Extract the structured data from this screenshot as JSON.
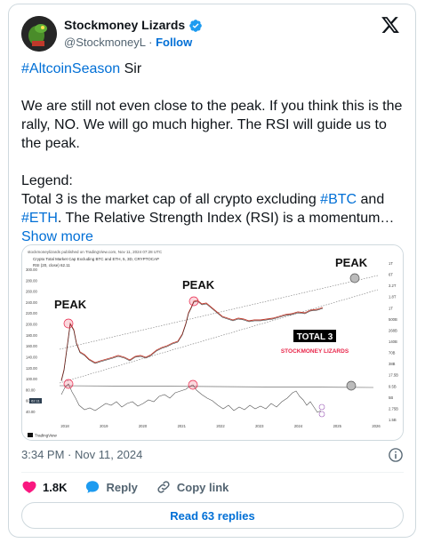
{
  "author": {
    "name": "Stockmoney Lizards",
    "handle": "@StockmoneyL",
    "separator": "·",
    "follow_label": "Follow"
  },
  "tweet": {
    "hashtag": "#AltcoinSeason",
    "hashtag_suffix": " Sir",
    "para2": "We are still not even close to the peak. If you think this is the rally, NO. We will go much higher.  The RSI will guide us to the peak.",
    "legend_heading": "Legend:",
    "legend_text_1": "Total 3 is the market cap of all crypto excluding ",
    "btc_tag": "#BTC",
    "legend_text_2": " and ",
    "eth_tag": "#ETH",
    "legend_text_3": ". The Relative Strength Index (RSI) is a momentum… ",
    "show_more": "Show more"
  },
  "chart": {
    "source_label": "stockmoneylizards published on TradingView.com, Nov 11, 2024 07:28 UTC",
    "series_label": "Crypto Total Market Cap Excluding BTC and ETH, 5, 3D, CRYPTOCAP",
    "rsi_label": "RSI (20, close)  62.11",
    "annotation_peak_1": "PEAK",
    "annotation_peak_2": "PEAK",
    "annotation_peak_3": "PEAK",
    "total3_label": "TOTAL 3",
    "brand_label": "STOCKMONEY LIZARDS",
    "tradingview_label": "TradingView",
    "rsi_value_badge": "62.11",
    "accent_red": "#e8264a",
    "chart_data": {
      "type": "line",
      "x_ticks": [
        "2018",
        "2019",
        "2020",
        "2021",
        "2022",
        "2023",
        "2024",
        "2025",
        "2026"
      ],
      "left_y_ticks": [
        "300.00",
        "280.00",
        "260.00",
        "240.00",
        "220.00",
        "200.00",
        "180.00",
        "160.00",
        "140.00",
        "120.00",
        "100.00",
        "80.00",
        "60.00",
        "40.00"
      ],
      "right_y_ticks": [
        "1T",
        "6T",
        "3.2T",
        "1.8T",
        "1T",
        "500B",
        "268B",
        "140B",
        "70B",
        "38B",
        "17.5B",
        "9.5B",
        "5B",
        "2.75B",
        "1.5B"
      ]
    }
  },
  "meta": {
    "timestamp": "3:34 PM · Nov 11, 2024"
  },
  "actions": {
    "likes": "1.8K",
    "reply_label": "Reply",
    "copy_label": "Copy link"
  },
  "read_replies_label": "Read 63 replies",
  "colors": {
    "link": "#006fd6",
    "like": "#f91880",
    "verified": "#1d9bf0"
  }
}
